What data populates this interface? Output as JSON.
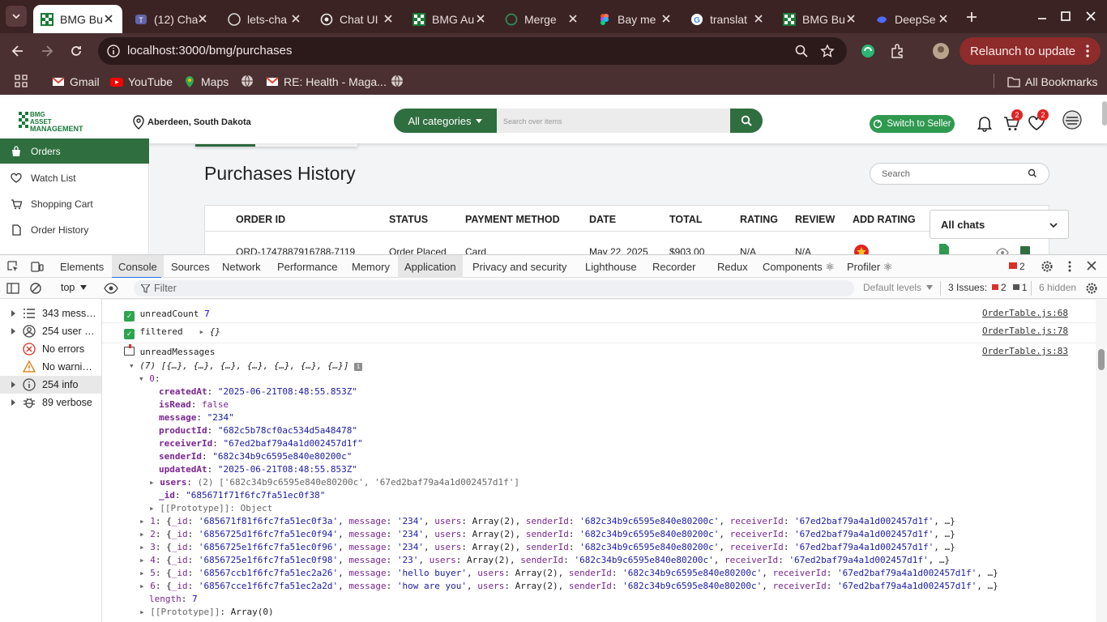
{
  "browser": {
    "tabs": [
      {
        "title": "BMG Bu",
        "icon": "bmg-favicon-icon",
        "active": true
      },
      {
        "title": "(12) Cha",
        "icon": "teams-favicon-icon"
      },
      {
        "title": "lets-cha",
        "icon": "github-favicon-icon"
      },
      {
        "title": "Chat UI",
        "icon": "openai-favicon-icon"
      },
      {
        "title": "BMG Au",
        "icon": "bmg-favicon-icon"
      },
      {
        "title": "Merge",
        "icon": "github-favicon-icon"
      },
      {
        "title": "Bay me",
        "icon": "figma-favicon-icon"
      },
      {
        "title": "translat",
        "icon": "google-favicon-icon"
      },
      {
        "title": "BMG Bu",
        "icon": "bmg-favicon-icon"
      },
      {
        "title": "DeepSe",
        "icon": "deepseek-favicon-icon"
      }
    ],
    "url": "localhost:3000/bmg/purchases",
    "relaunch": "Relaunch to update",
    "bookmarks": [
      "Gmail",
      "YouTube",
      "Maps",
      "RE: Health - Maga..."
    ],
    "all_bookmarks": "All Bookmarks"
  },
  "site": {
    "location": "Aberdeen, South Dakota",
    "all_categories": "All categories",
    "search_placeholder": "Search over items",
    "switch_seller": "Switch to Seller",
    "cart_badge": "2",
    "wish_badge": "2",
    "sidebar": [
      "Orders",
      "Watch List",
      "Shopping Cart",
      "Order History"
    ],
    "page_title": "Purchases History",
    "search_label": "Search",
    "columns": [
      "ORDER ID",
      "STATUS",
      "PAYMENT METHOD",
      "DATE",
      "TOTAL",
      "RATING",
      "REVIEW",
      "ADD RATING"
    ],
    "row": [
      "ORD-1747887916788-7119",
      "Order Placed",
      "Card",
      "May 22, 2025",
      "$903.00",
      "N/A",
      "N/A"
    ],
    "chats_dropdown": "All chats"
  },
  "devtools": {
    "tabs": [
      "Elements",
      "Console",
      "Sources",
      "Network",
      "Performance",
      "Memory",
      "Application",
      "Privacy and security",
      "Lighthouse",
      "Recorder",
      "Redux",
      "Components ⚛",
      "Profiler ⚛"
    ],
    "selected_tab": "Console",
    "error_count": "2",
    "context": "top",
    "filter_placeholder": "Filter",
    "levels": "Default levels",
    "issues_label": "3 Issues:",
    "issues_errors": "2",
    "issues_info": "1",
    "hidden": "6 hidden",
    "side": [
      "343 mess…",
      "254 user …",
      "No errors",
      "No warni…",
      "254 info",
      "89 verbose"
    ],
    "log": {
      "unread_label": "unreadCount",
      "unread_value": "7",
      "unread_src": "OrderTable.js:68",
      "filtered_label": "filtered",
      "filtered_value": "{}",
      "filtered_src": "OrderTable.js:78",
      "messages_label": "unreadMessages",
      "messages_src": "OrderTable.js:83",
      "array_summary": "(7) [{…}, {…}, {…}, {…}, {…}, {…}, {…}]",
      "item0": {
        "createdAt": "\"2025-06-21T08:48:55.853Z\"",
        "isRead": "false",
        "message": "\"234\"",
        "productId": "\"682c5b78cf0ac534d5a48478\"",
        "receiverId": "\"67ed2baf79a4a1d002457d1f\"",
        "senderId": "\"682c34b9c6595e840e80200c\"",
        "updatedAt": "\"2025-06-21T08:48:55.853Z\"",
        "users": "(2) ['682c34b9c6595e840e80200c', '67ed2baf79a4a1d002457d1f']",
        "_id": "\"685671f71f6fc7fa51ec0f38\"",
        "prototype": "[[Prototype]]: Object"
      },
      "items": [
        {
          "idx": "1",
          "id": "'685671f81f6fc7fa51ec0f3a'",
          "msg": "'234'"
        },
        {
          "idx": "2",
          "id": "'6856725d1f6fc7fa51ec0f94'",
          "msg": "'234'"
        },
        {
          "idx": "3",
          "id": "'6856725e1f6fc7fa51ec0f96'",
          "msg": "'234'"
        },
        {
          "idx": "4",
          "id": "'6856725e1f6fc7fa51ec0f98'",
          "msg": "'23'"
        },
        {
          "idx": "5",
          "id": "'68567ccb1f6fc7fa51ec2a26'",
          "msg": "'hello buyer'"
        },
        {
          "idx": "6",
          "id": "'68567cce1f6fc7fa51ec2a2d'",
          "msg": "'how are you'"
        }
      ],
      "item_users": "Array(2)",
      "item_sender": "'682c34b9c6595e840e80200c'",
      "item_receiver": "'67ed2baf79a4a1d002457d1f'",
      "length": "7",
      "proto_array": "Array(0)"
    }
  }
}
